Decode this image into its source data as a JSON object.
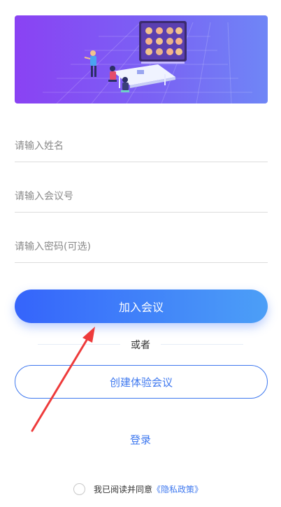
{
  "banner": {
    "illustration": "video-meeting-illustration",
    "colors": {
      "gradient_start": "#8a42f3",
      "gradient_end": "#6f86f6"
    }
  },
  "form": {
    "name_placeholder": "请输入姓名",
    "meeting_id_placeholder": "请输入会议号",
    "password_placeholder": "请输入密码(可选)"
  },
  "actions": {
    "join_label": "加入会议",
    "or_label": "或者",
    "create_label": "创建体验会议",
    "login_label": "登录"
  },
  "agreement": {
    "prefix": "我已阅读并同意",
    "link": "《隐私政策》",
    "checked": false
  },
  "colors": {
    "accent": "#3e78ef",
    "annotation_arrow": "#ee3b3b"
  }
}
